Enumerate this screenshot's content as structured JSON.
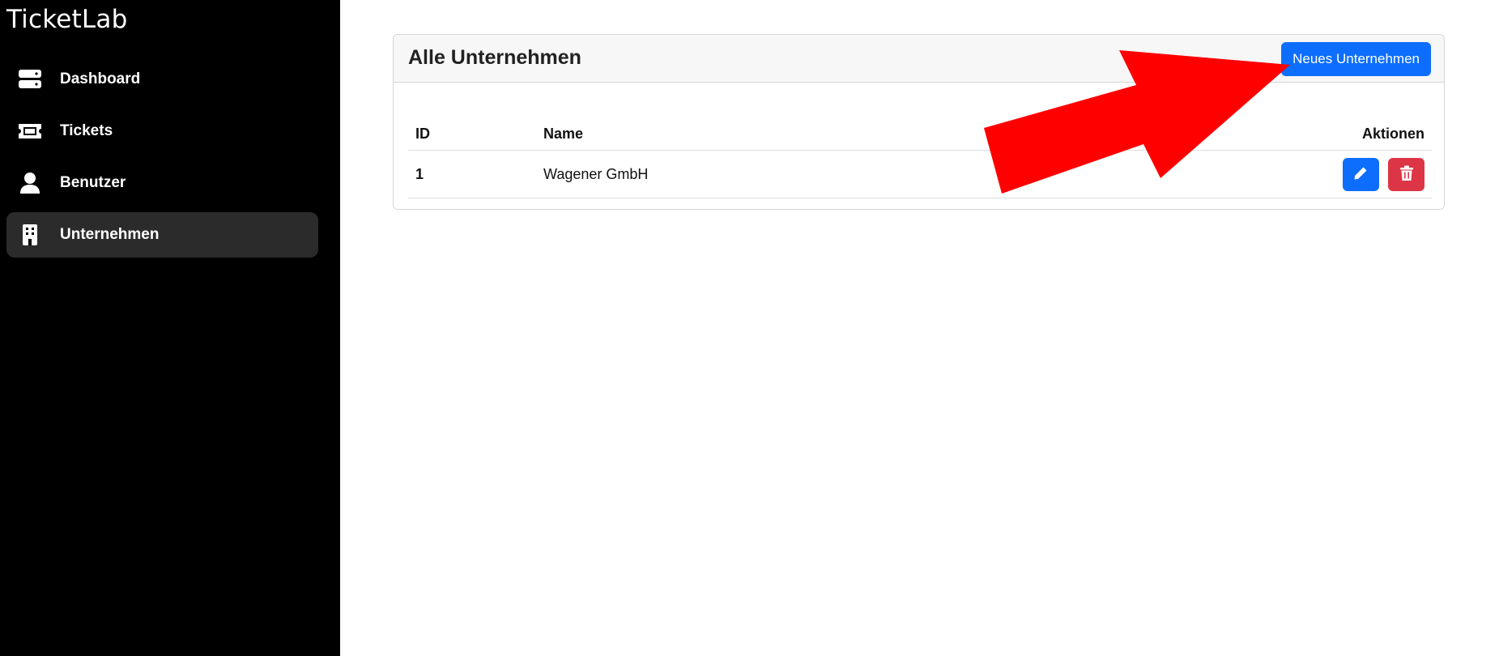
{
  "sidebar": {
    "brand": "TicketLab",
    "items": [
      {
        "label": "Dashboard",
        "icon": "server-icon",
        "active": false
      },
      {
        "label": "Tickets",
        "icon": "ticket-icon",
        "active": false
      },
      {
        "label": "Benutzer",
        "icon": "user-icon",
        "active": false
      },
      {
        "label": "Unternehmen",
        "icon": "building-icon",
        "active": true
      }
    ]
  },
  "main": {
    "card": {
      "title": "Alle Unternehmen",
      "new_button_label": "Neues Unternehmen",
      "table": {
        "headers": {
          "id": "ID",
          "name": "Name",
          "actions": "Aktionen"
        },
        "rows": [
          {
            "id": "1",
            "name": "Wagener GmbH"
          }
        ]
      }
    }
  },
  "colors": {
    "sidebar_bg": "#000000",
    "active_item_bg": "#2b2b2b",
    "primary": "#0d6efd",
    "danger": "#dc3545",
    "annotation_arrow": "#ff0000"
  }
}
